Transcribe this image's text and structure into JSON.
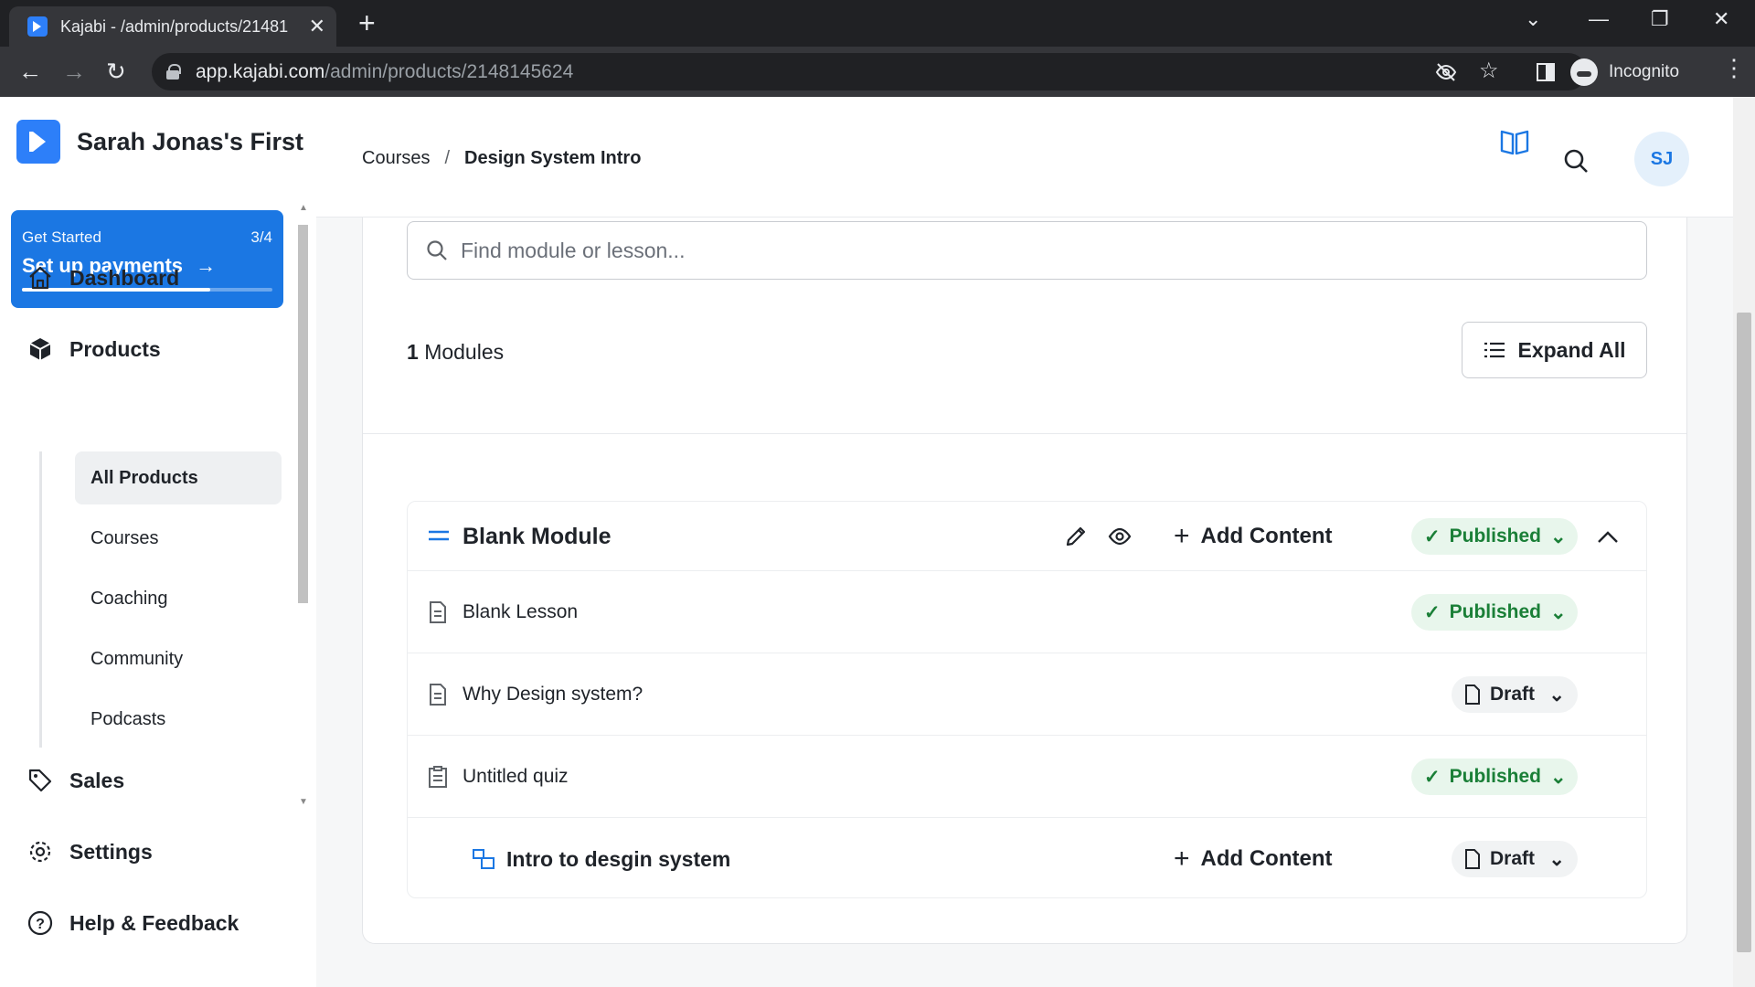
{
  "browser": {
    "tab_title": "Kajabi - /admin/products/21481",
    "url_domain": "app.kajabi.com",
    "url_path": "/admin/products/2148145624",
    "profile_label": "Incognito"
  },
  "sidebar": {
    "brand_name": "Sarah Jonas's First",
    "get_started": {
      "label": "Get Started",
      "progress_text": "3/4",
      "title": "Set up payments",
      "progress": 0.75
    },
    "nav": {
      "dashboard": "Dashboard",
      "products": "Products",
      "sales": "Sales",
      "settings": "Settings",
      "help": "Help & Feedback"
    },
    "product_items": [
      "All Products",
      "Courses",
      "Coaching",
      "Community",
      "Podcasts"
    ]
  },
  "header": {
    "breadcrumb": [
      "Courses",
      "Design System Intro"
    ],
    "breadcrumb_sep": "/",
    "avatar_initials": "SJ"
  },
  "content": {
    "search_placeholder": "Find module or lesson...",
    "modules_count": "1",
    "modules_label": "Modules",
    "expand_all": "Expand All",
    "module": {
      "title": "Blank Module",
      "add_content": "Add Content",
      "status": "Published",
      "lessons": [
        {
          "title": "Blank Lesson",
          "status": "Published"
        },
        {
          "title": "Why Design system?",
          "status": "Draft"
        },
        {
          "title": "Untitled quiz",
          "status": "Published"
        }
      ],
      "submodule": {
        "title": "Intro to desgin system",
        "add_content": "Add Content",
        "status": "Draft"
      }
    }
  },
  "colors": {
    "brand": "#2d7ff9",
    "published_bg": "#e8f6ec",
    "published_text": "#1a7f37"
  }
}
